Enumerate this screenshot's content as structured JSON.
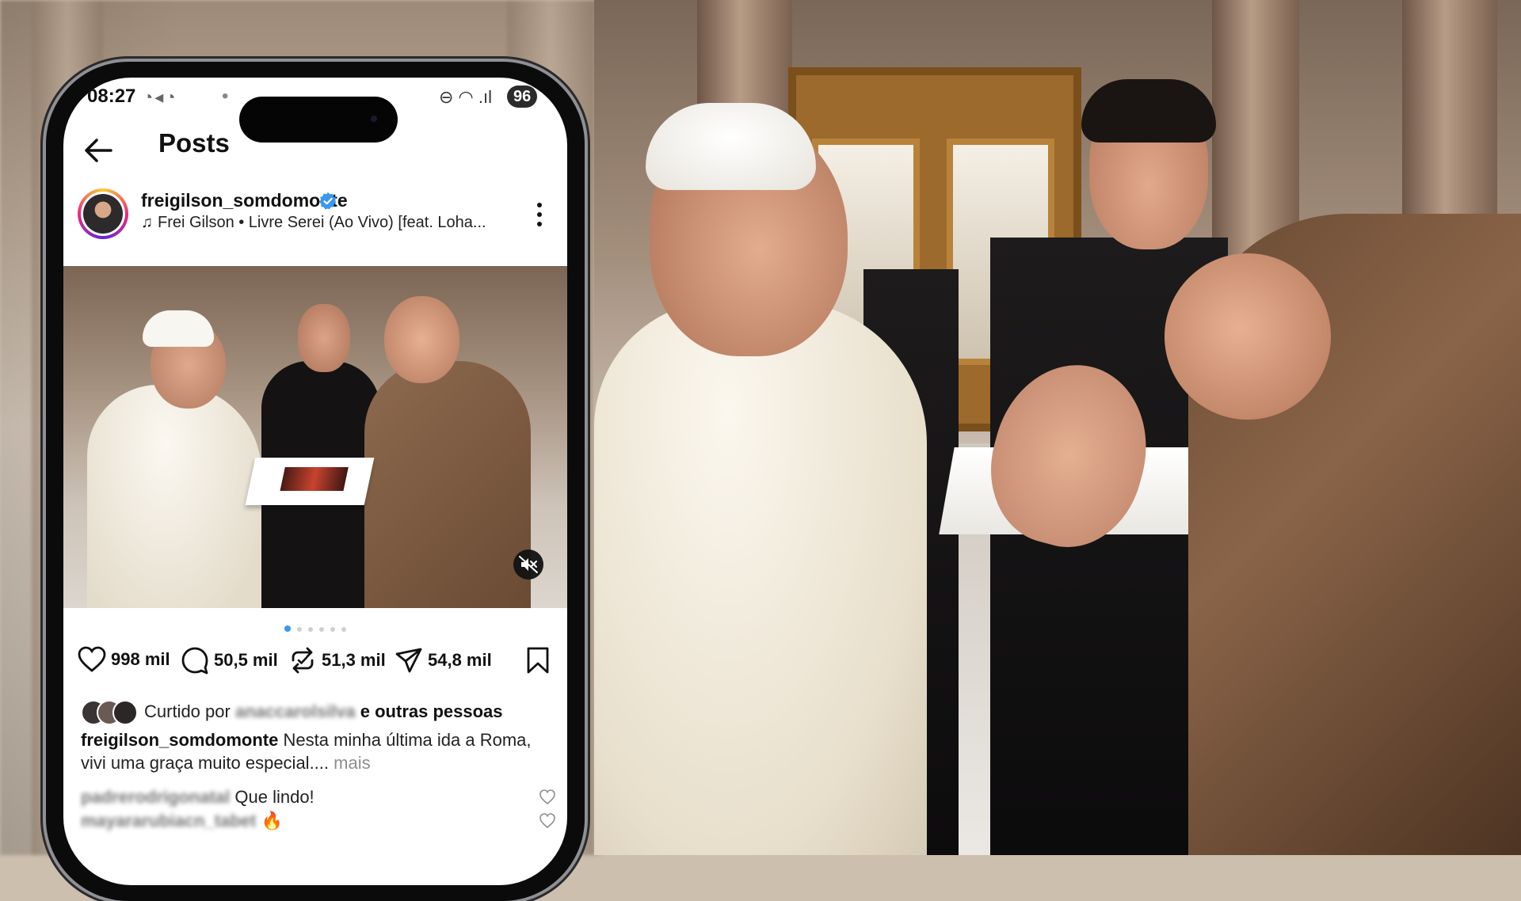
{
  "status_bar": {
    "time": "08:27",
    "app_icons": "◔◂◔",
    "dot": "•",
    "system_icons": "⊖ ◠ .ıl",
    "battery": "96"
  },
  "header": {
    "title": "Posts"
  },
  "post": {
    "username": "freigilson_somdomonte",
    "verified": true,
    "music": "Frei Gilson • Livre Serei (Ao Vivo) [feat. Loha...",
    "carousel_count": 6,
    "carousel_active": 0,
    "likes": "998 mil",
    "comments": "50,5 mil",
    "reposts": "51,3 mil",
    "shares": "54,8 mil",
    "liked_by_prefix": "Curtido por",
    "liked_by_user": "anaccarolsilva",
    "liked_by_suffix": "e outras pessoas",
    "caption_user": "freigilson_somdomonte",
    "caption_text": "Nesta minha última ida a Roma, vivi uma graça muito especial....",
    "caption_more": "mais",
    "comments_list": [
      {
        "user": "padrerodrigonatal",
        "text": "Que lindo!"
      },
      {
        "user": "mayararubiacn_tabet",
        "text": "🔥"
      }
    ]
  },
  "colors": {
    "verified_blue": "#3897f0",
    "carousel_active": "#3897f0",
    "text_primary": "#111111",
    "text_muted": "#8e8e8e"
  }
}
